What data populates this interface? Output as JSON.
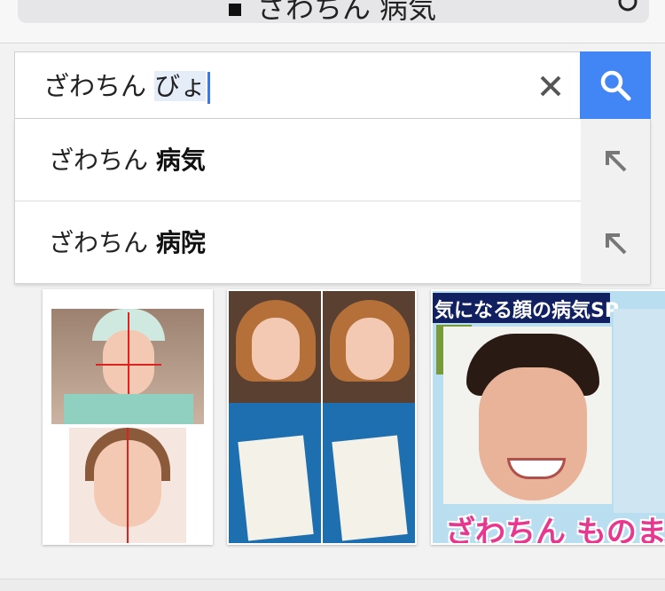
{
  "address_bar": {
    "text": "ざわちん 病気"
  },
  "search": {
    "typed_prefix": "ざわちん ",
    "typed_composing": "びょ",
    "clear_icon": "close-icon",
    "submit_icon": "search-icon",
    "accent_color": "#4285f4"
  },
  "suggestions": [
    {
      "prefix": "ざわちん ",
      "completion": "病気",
      "fill_icon": "arrow-up-left-icon"
    },
    {
      "prefix": "ざわちん ",
      "completion": "病院",
      "fill_icon": "arrow-up-left-icon"
    }
  ],
  "image_results": {
    "caption_3": "気になる顔の病気SP",
    "caption_3_bottom": "ざわちん ものま"
  }
}
